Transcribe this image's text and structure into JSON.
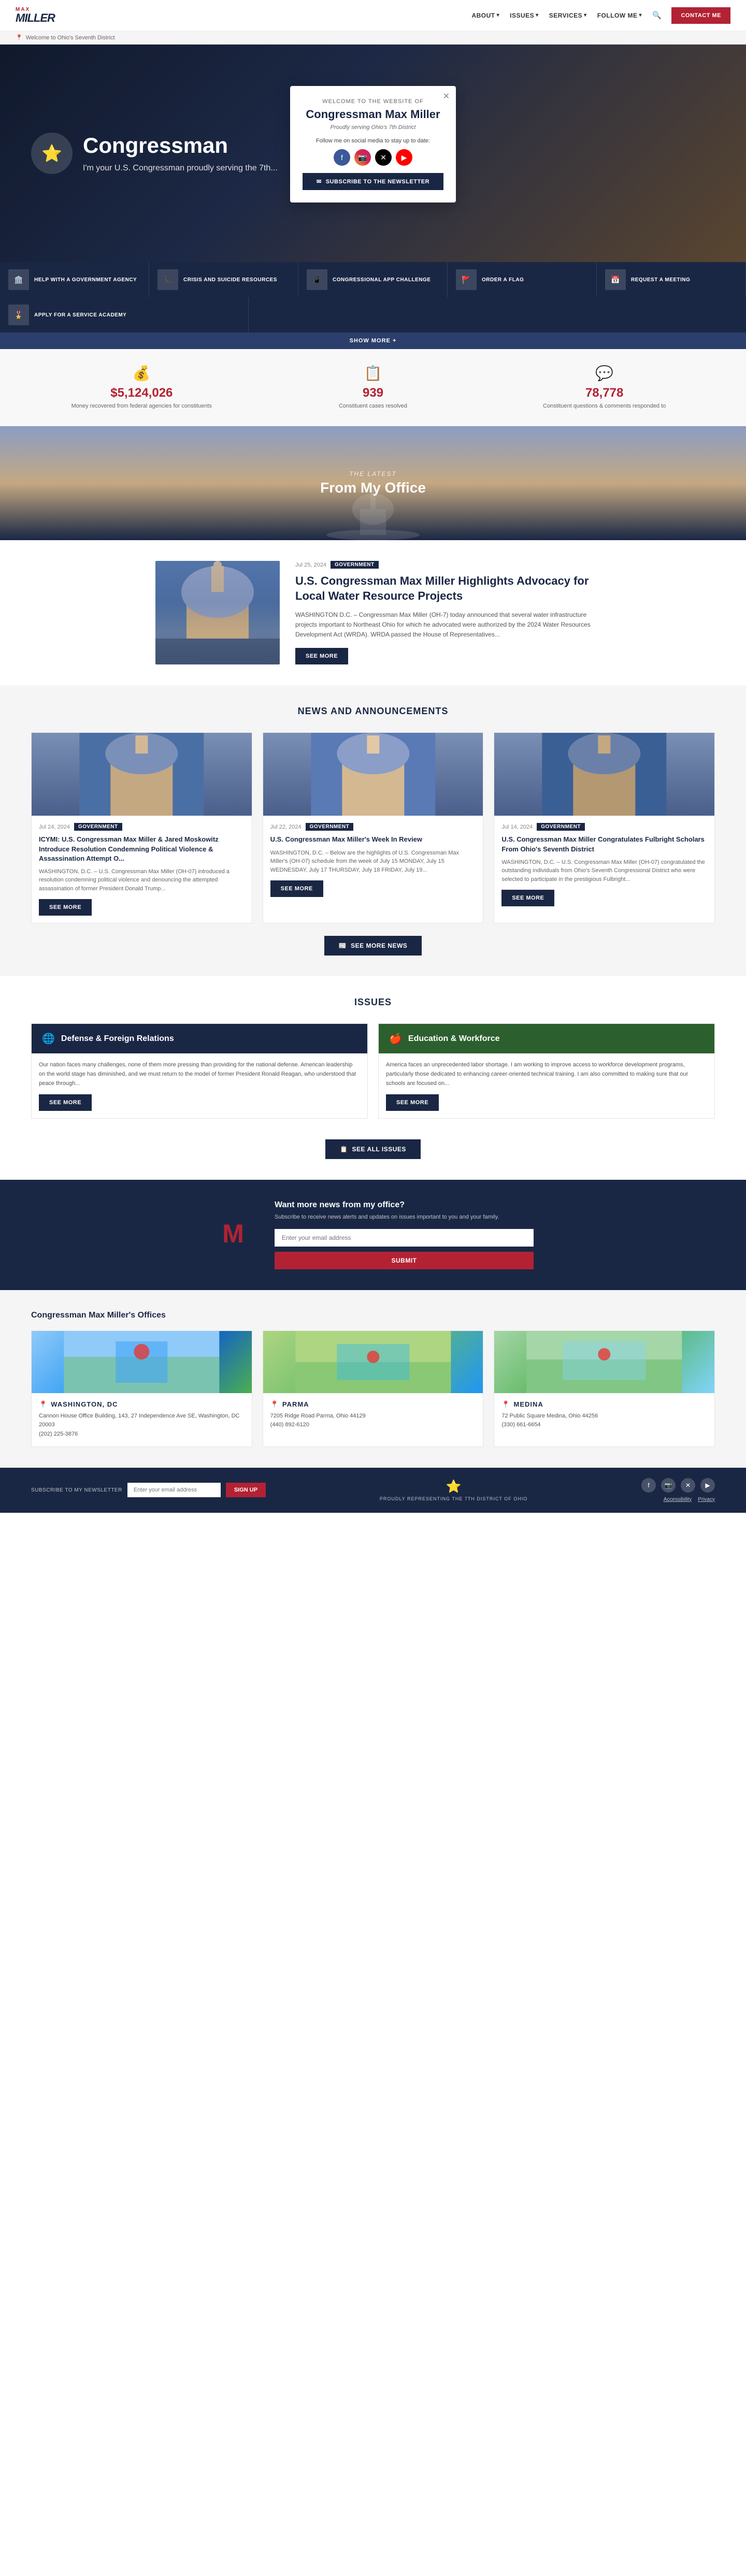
{
  "site": {
    "logo_name": "MILLER",
    "logo_tagline": "MAX MILLER",
    "district_bar": "Welcome to Ohio's Seventh District"
  },
  "nav": {
    "about_label": "ABOUT",
    "issues_label": "ISSUES",
    "services_label": "SERVICES",
    "follow_label": "FOLLOW ME",
    "contact_label": "CONTACT ME"
  },
  "modal": {
    "welcome_text": "Welcome to the website of",
    "name": "Congressman Max Miller",
    "serving": "Proudly serving Ohio's 7th District",
    "follow_text": "Follow me on social media to stay up to date:",
    "subscribe_label": "SUBSCRIBE TO THE NEWSLETTER"
  },
  "quick_links": [
    {
      "label": "HELP WITH A GOVERNMENT AGENCY"
    },
    {
      "label": "CRISIS AND SUICIDE RESOURCES"
    },
    {
      "label": "CONGRESSIONAL APP CHALLENGE"
    },
    {
      "label": "ORDER A FLAG"
    },
    {
      "label": "REQUEST A MEETING"
    },
    {
      "label": "APPLY FOR A SERVICE ACADEMY"
    }
  ],
  "show_more": "SHOW MORE +",
  "stats": [
    {
      "number": "$5,124,026",
      "description": "Money recovered from federal agencies for constituents"
    },
    {
      "number": "939",
      "description": "Constituent cases resolved"
    },
    {
      "number": "78,778",
      "description": "Constituent questions & comments responded to"
    }
  ],
  "from_office": {
    "sub_label": "The Latest",
    "title": "From My Office"
  },
  "featured_article": {
    "date": "Jul 25, 2024",
    "badge": "Government",
    "title": "U.S. Congressman Max Miller Highlights Advocacy for Local Water Resource Projects",
    "excerpt": "WASHINGTON D.C. – Congressman Max Miller (OH-7) today announced that several water infrastructure projects important to Northeast Ohio for which he advocated were authorized by the 2024 Water Resources Development Act (WRDA). WRDA passed the House of Representatives...",
    "see_more": "SEE MORE"
  },
  "news_section": {
    "title": "News and Announcements",
    "see_more_news": "SEE MORE NEWS",
    "articles": [
      {
        "date": "Jul 24, 2024",
        "badge": "Government",
        "title": "ICYMI: U.S. Congressman Max Miller & Jared Moskowitz Introduce Resolution Condemning Political Violence & Assassination Attempt O...",
        "excerpt": "WASHINGTON, D.C. – U.S. Congressman Max Miller (OH-07) introduced a resolution condemning political violence and denouncing the attempted assassination of former President Donald Trump...",
        "see_more": "SEE MORE"
      },
      {
        "date": "Jul 22, 2024",
        "badge": "Government",
        "title": "U.S. Congressman Max Miller's Week In Review",
        "excerpt": "WASHINGTON, D.C. – Below are the highlights of U.S. Congressman Max Miller's (OH-07) schedule from the week of July 15 MONDAY, July 15 WEDNESDAY, July 17 THURSDAY, July 18 FRIDAY, July 19...",
        "see_more": "SEE MORE"
      },
      {
        "date": "Jul 14, 2024",
        "badge": "Government",
        "title": "U.S. Congressman Max Miller Congratulates Fulbright Scholars From Ohio's Seventh District",
        "excerpt": "WASHINGTON, D.C. – U.S. Congressman Max Miller (OH-07) congratulated the outstanding individuals from Ohio's Seventh Congressional District who were selected to participate in the prestigious Fulbright...",
        "see_more": "SEE MORE"
      }
    ]
  },
  "issues_section": {
    "title": "Issues",
    "see_all": "SEE ALL ISSUES",
    "issues": [
      {
        "title": "Defense & Foreign Relations",
        "text": "Our nation faces many challenges, none of them more pressing than providing for the national defense. American leadership on the world stage has diminished, and we must return to the model of former President Ronald Reagan, who understood that peace through...",
        "see_more": "SEE MORE",
        "color": "defense"
      },
      {
        "title": "Education & Workforce",
        "text": "America faces an unprecedented labor shortage. I am working to improve access to workforce development programs, particularly those dedicated to enhancing career-oriented technical training. I am also committed to making sure that our schools are focused on...",
        "see_more": "SEE MORE",
        "color": "education"
      }
    ]
  },
  "newsletter": {
    "title": "Want more news from my office?",
    "subtitle": "Subscribe to receive news alerts and updates on issues important to you and your family.",
    "placeholder": "Enter your email address",
    "submit": "SUBMIT"
  },
  "offices_section": {
    "title": "Congressman Max Miller's Offices",
    "offices": [
      {
        "city": "WASHINGTON, DC",
        "address": "Cannon House Office Building, 143, 27 Independence Ave SE, Washington, DC 20003",
        "phone": "(202) 225-3876",
        "map_class": "office-map-dc"
      },
      {
        "city": "PARMA",
        "address": "7205 Ridge Road\nParma, Ohio 44129",
        "phone": "(440) 892-6120",
        "map_class": "office-map-parma"
      },
      {
        "city": "MEDINA",
        "address": "72 Public Square\nMedina, Ohio 44256",
        "phone": "(330) 661-6654",
        "map_class": "office-map-medina"
      }
    ]
  },
  "footer": {
    "newsletter_placeholder": "Enter your email address",
    "signup_label": "SIGN UP",
    "representing": "PROUDLY REPRESENTING THE 7TH DISTRICT OF OHIO",
    "links": [
      "Accessibility",
      "Privacy"
    ]
  },
  "social": {
    "facebook": "f",
    "instagram": "📷",
    "twitter": "✕",
    "youtube": "▶"
  }
}
